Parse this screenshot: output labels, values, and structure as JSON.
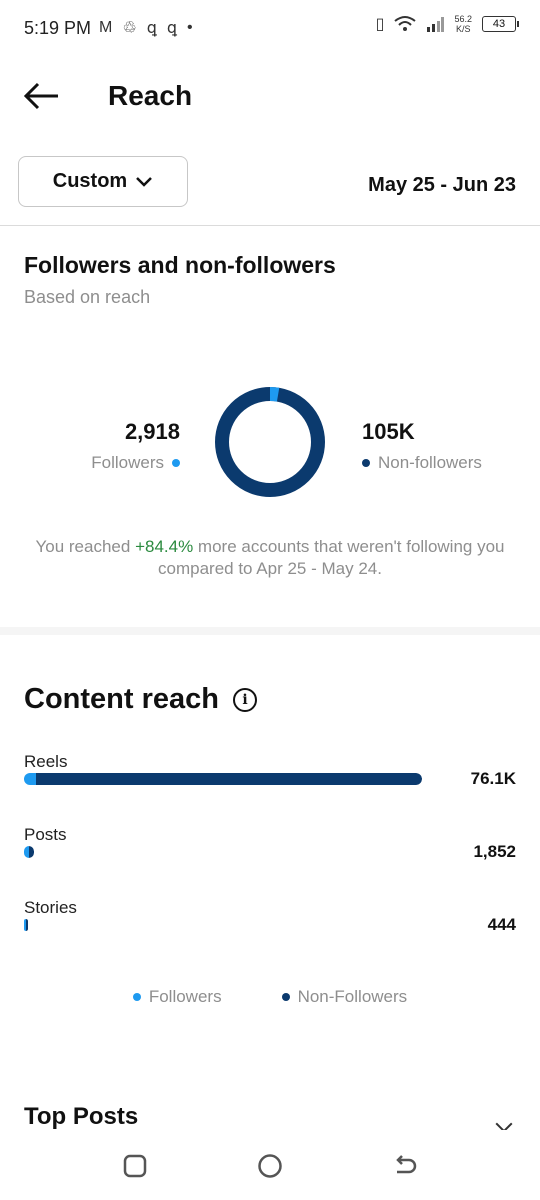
{
  "status_bar": {
    "time": "5:19 PM",
    "speed_value": "56.2",
    "speed_unit": "K/S",
    "battery": "43"
  },
  "header": {
    "title": "Reach",
    "back_icon": "arrow-left-icon"
  },
  "filter": {
    "period_label": "Custom",
    "date_range": "May 25 - Jun 23"
  },
  "followers_section": {
    "title": "Followers and non-followers",
    "subtitle": "Based on reach",
    "followers_value": "2,918",
    "followers_label": "Followers",
    "non_followers_value": "105K",
    "non_followers_label": "Non-followers",
    "followers_share": 0.027,
    "note_before": "You reached ",
    "note_pct": "+84.4%",
    "note_after": " more accounts that weren't following you compared to Apr 25 - May 24."
  },
  "content_reach": {
    "title": "Content reach",
    "info_icon": "info-icon",
    "rows": [
      {
        "label": "Reels",
        "value": "76.1K",
        "total": 76100,
        "followers_share": 0.03
      },
      {
        "label": "Posts",
        "value": "1,852",
        "total": 1852,
        "followers_share": 0.5
      },
      {
        "label": "Stories",
        "value": "444",
        "total": 444,
        "followers_share": 0.5
      }
    ],
    "legend": {
      "followers": "Followers",
      "non_followers": "Non-Followers"
    }
  },
  "top_posts": {
    "title": "Top Posts"
  },
  "colors": {
    "followers": "#1e9af0",
    "non_followers": "#0b3a6e",
    "positive": "#2a8a3e"
  }
}
